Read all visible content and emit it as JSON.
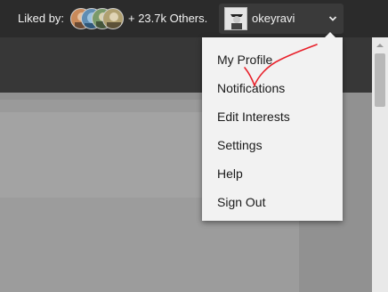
{
  "header": {
    "liked_by_label": "Liked by:",
    "others_text": "+ 23.7k Others.",
    "likers": [
      {
        "icon": "liker-avatar",
        "color": "#c98a5a"
      },
      {
        "icon": "liker-avatar",
        "color": "#5f8db3"
      },
      {
        "icon": "liker-avatar",
        "color": "#7a9a6a"
      },
      {
        "icon": "liker-avatar",
        "color": "#b0a070"
      }
    ],
    "user": {
      "username": "okeyravi",
      "avatar_icon": "user-avatar",
      "dropdown_icon": "chevron-down-icon"
    }
  },
  "menu": {
    "items": [
      {
        "label": "My Profile"
      },
      {
        "label": "Notifications"
      },
      {
        "label": "Edit Interests"
      },
      {
        "label": "Settings"
      },
      {
        "label": "Help"
      },
      {
        "label": "Sign Out"
      }
    ]
  },
  "annotation": {
    "color": "#e8202a",
    "shape": "hand-drawn checkmark under My Profile"
  },
  "colors": {
    "topbar": "#2b2b2b",
    "menu_background": "#f2f2f2",
    "page_overlay": "#8a8a8a"
  }
}
